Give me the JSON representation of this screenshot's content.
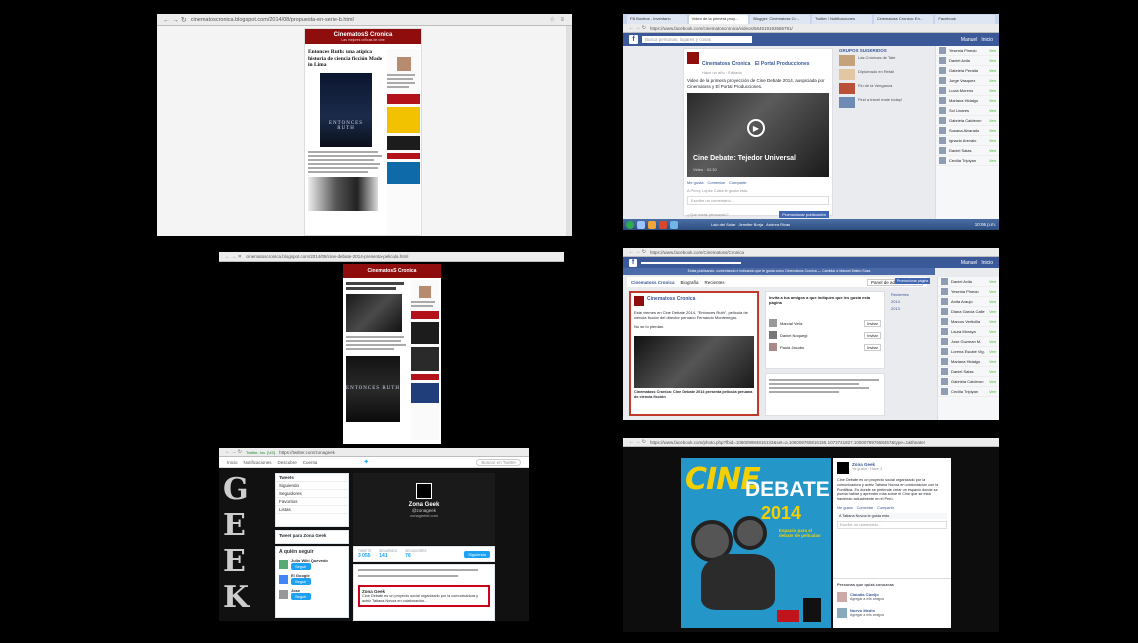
{
  "panels": {
    "blog_top": {
      "url_host": "cinematoscronica.blogspot.com",
      "url_path": "/2014/08/propuesta-en-serie-b.html",
      "blog_name": "CinematosS Cronica",
      "blog_tagline": "Las mejores críticas de cine",
      "post_title": "Entonces Ruth: una atípica historia de ciencia ficción Made in Lima",
      "poster_text": "ENTONCES RUTH"
    },
    "fb_video": {
      "tabs": [
        "FB Bonitos - Inventario",
        "Video de la primera proy...",
        "Blogger: Cinematoss Cr...",
        "Twitter / Notificaciones",
        "Cinematoss Cronica: En...",
        "Facebook"
      ],
      "url": "https://www.facebook.com/cinematoscronica/videos/564519193586791/",
      "search_placeholder": "Busca personas, lugares y cosas",
      "user_name": "Manuel",
      "home_label": "Inicio",
      "page_name": "Cinematoss Cronica",
      "shared_with": "El Portal Producciones",
      "post_meta": "Hace un año · Editado",
      "post_text": "Video de la primera proyección de Cine Debate 2014, auspiciada por Cinematoss y El Portal Producciones.",
      "video_title": "Cine Debate: Tejedor Universal",
      "video_meta": "Video",
      "video_duration": "02:30",
      "actions": [
        "Me gusta",
        "Comentar",
        "Compartir"
      ],
      "likes": "A Percy Lopez Cuba le gusta esto.",
      "comment_placeholder": "Escribe un comentario...",
      "composer_placeholder": "¿Qué estás pensando?",
      "promote": "Promocionar publicación",
      "right_header": "GRUPOS SUGERIDOS",
      "right_items": [
        "Las Crónicas de Tate",
        "Diplomado en Retail",
        "Fin de la Venganza",
        "Find a travel mate today!"
      ],
      "chat_contacts": [
        "Yesenia Pinedo",
        "Daniel Avila",
        "Gabriela Peralta",
        "Jorge Vasquez",
        "Lucia Moreno",
        "Mariana Hidalgo",
        "Sol Linares",
        "Gabriela Calderon",
        "Susana Alvarado",
        "Ignacio Arevalo",
        "Daniel Salas",
        "Cecilia Tripiyan"
      ],
      "chat_status": "Ven",
      "taskbar_items": [
        "Lalo del Solar",
        "Jennifer Borja",
        "Andrea Rivas"
      ],
      "clock": "10:06 p.m."
    },
    "blog_mid": {
      "url_host": "cinematoscronica.blogspot.com",
      "url_path": "/2014/08/cine-debate-2014-presenta-pelicula.html",
      "blog_name": "CinematosS Cronica",
      "poster_text": "ENTONCES RUTH"
    },
    "fb_page": {
      "url": "https://www.facebook.com/Cinematoss/Cronica",
      "user_name": "Manuel",
      "home_label": "Inicio",
      "banner": "Estás publicando, comentando e indicando que te gusta como Cinematoss Cronica — Cambiar a Manuel Mateo Sosa",
      "page_name": "Cinematoss Cronica",
      "tabs": [
        "Biografía",
        "Recientes"
      ],
      "admin_panel": "Panel de administración",
      "promote": "Promocionar página",
      "post_text": "Este viernes en Cine Debate 2014, \"Entonces Ruth\", película de ciencia ficción del director peruano Fernando Montenegro.",
      "post_text2": "No se lo pierdan.",
      "video_caption": "Cinematoss Cronica: Cine Debate 2014 presenta película peruana de ciencia ficción",
      "invite_title": "Invita a tus amigos a que indiquen que les gusta esta página",
      "invite_people": [
        "Marcial Veliz",
        "Daniel Noquegi",
        "Paola Jacobs"
      ],
      "invite_label": "Invitar",
      "year_list": [
        "Recientes",
        "2014",
        "2013"
      ],
      "chat_contacts": [
        "Daniel Avila",
        "Yesenia Pinedo",
        "Anita Araujo",
        "Diana Garcia Calle",
        "Marcos Verticilla",
        "Laura Moraya",
        "Jose Guzman M.",
        "Lorena Escate Vig.",
        "Mariana Hidalgo",
        "Daniel Salas",
        "Gabriela Calderon",
        "Cecilia Tripiyan"
      ],
      "chat_status": "Ven"
    },
    "twitter": {
      "url_badge": "Twitter, Inc. [US]",
      "url": "https://twitter.com/zonageek",
      "nav": [
        "Inicio",
        "Notificaciones",
        "Descubre",
        "Cuenta"
      ],
      "search_placeholder": "Buscar en Twitter",
      "sidebar_rows": [
        "Tweets",
        "Siguiendo",
        "Seguidores",
        "Favoritos",
        "Listas"
      ],
      "tweet_to": "Tweet para Zona Geek",
      "who_to_follow": "A quién seguir",
      "suggestions": [
        "Julio Wiki Quevedo",
        "El Google",
        "Jose"
      ],
      "follow_label": "Seguir",
      "profile_name": "Zona Geek",
      "profile_handle": "@zonageek",
      "profile_site": "zonageekti.com",
      "stats": [
        {
          "label": "TWEETS",
          "value": "3 055"
        },
        {
          "label": "SIGUIENDO",
          "value": "141"
        },
        {
          "label": "SEGUIDORES",
          "value": "76"
        }
      ],
      "follow_btn": "Siguiendo",
      "tweet_author": "Zona Geek",
      "tweet_text": "Cine Debate es un proyecto social organizado por la comunicadora y actriz Tatiana Novoa en colaboración..."
    },
    "fb_photo": {
      "url": "https://www.facebook.com/photo.php?fbid=106009984816133&set=a.106009760816155.1073741827.100007897658457&type=1&theater",
      "poster_word": "CINE",
      "poster_title": "DEBATE",
      "poster_year": "2014",
      "poster_sub": "Espacio para el debate de películas",
      "page_name": "Zona Geek",
      "meta": "Ya gusta · Hace 3",
      "text": "Cine Debate es un proyecto social organizado por la comunicadora y actriz Tatiana Novoa en colaboración con la Pontificia. En donde se pretende crear un espacio donde se pueda hablar y aprender más sobre el Cine que se está haciendo actualmente en el Perú.",
      "actions": [
        "Me gusta",
        "Comentar",
        "Compartir"
      ],
      "likes": "A Tatiana Novoa le gusta esto.",
      "comment_placeholder": "Escribe un comentario...",
      "also_liked": "Personas que quizá conozcas",
      "people": [
        "Claudia Clavijo",
        "Nuevo Medio"
      ],
      "add_friend": "Agregar a mis amigos"
    }
  }
}
